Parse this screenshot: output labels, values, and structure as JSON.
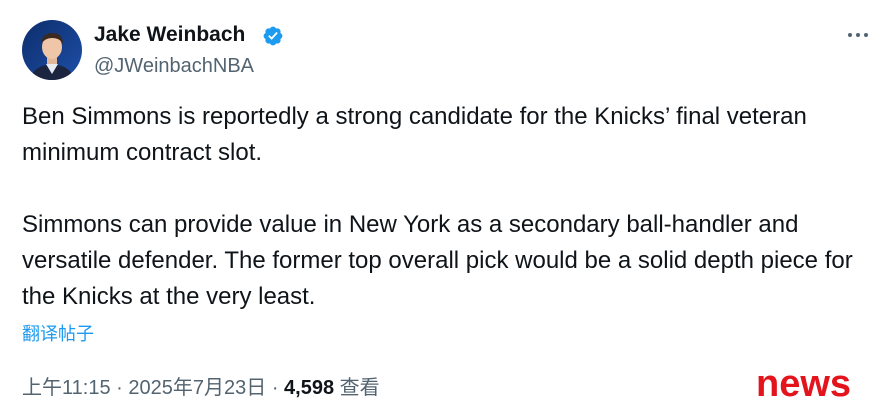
{
  "author": {
    "name": "Jake Weinbach",
    "handle": "@JWeinbachNBA",
    "verified": true
  },
  "icons": {
    "verified": "verified-badge-icon",
    "more": "more-options-icon"
  },
  "tweet": {
    "paragraphs": [
      "Ben Simmons is reportedly a strong candidate for the Knicks’ final veteran minimum contract slot.",
      "Simmons can provide value in New York as a secondary ball-handler and versatile defender. The former top overall pick would be a solid depth piece for the Knicks at the very least."
    ],
    "translate_label": "翻译帖子"
  },
  "meta": {
    "time": "上午11:15",
    "separator1": "·",
    "date": "2025年7月23日",
    "separator2": "·",
    "views_count": "4,598",
    "views_label": "查看"
  },
  "watermark": {
    "text": "news"
  },
  "colors": {
    "accent": "#1d9bf0",
    "text": "#0f1419",
    "secondary_text": "#536471",
    "watermark": "#e3141c"
  }
}
